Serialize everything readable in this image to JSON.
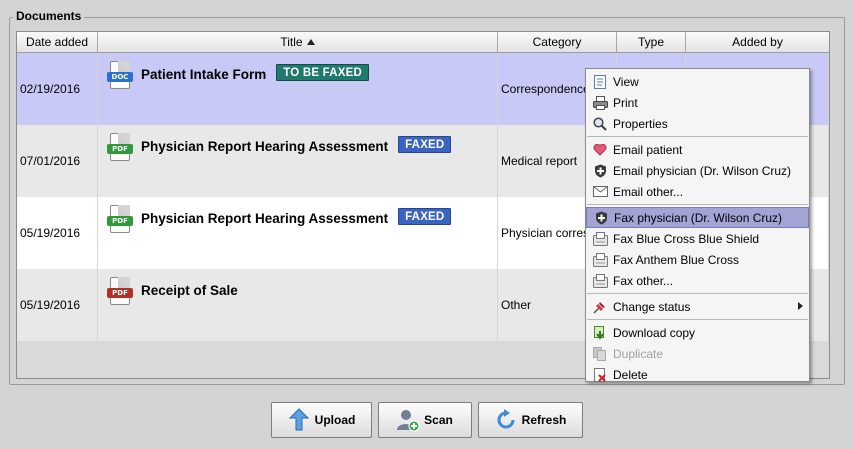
{
  "panel": {
    "legend": "Documents"
  },
  "table": {
    "columns": [
      "Date added",
      "Title",
      "Category",
      "Type",
      "Added by"
    ],
    "rows": [
      {
        "date": "02/19/2016",
        "file_type": "DOC",
        "title": "Patient Intake Form",
        "badge": "TO BE FAXED",
        "category": "Correspondence"
      },
      {
        "date": "07/01/2016",
        "file_type": "PDF",
        "title": "Physician Report Hearing Assessment",
        "badge": "FAXED",
        "category": "Medical report"
      },
      {
        "date": "05/19/2016",
        "file_type": "PDF",
        "title": "Physician Report Hearing Assessment",
        "badge": "FAXED",
        "category": "Physician correspondence"
      },
      {
        "date": "05/19/2016",
        "file_type": "PDF",
        "title": "Receipt of Sale",
        "badge": "",
        "category": "Other"
      }
    ]
  },
  "context_menu": {
    "view": "View",
    "print": "Print",
    "properties": "Properties",
    "email_patient": "Email patient",
    "email_physician": "Email physician (Dr. Wilson Cruz)",
    "email_other": "Email other...",
    "fax_physician": "Fax physician (Dr. Wilson Cruz)",
    "fax_bcbs": "Fax Blue Cross Blue Shield",
    "fax_anthem": "Fax Anthem Blue Cross",
    "fax_other": "Fax other...",
    "change_status": "Change status",
    "download_copy": "Download copy",
    "duplicate": "Duplicate",
    "delete": "Delete"
  },
  "buttons": {
    "upload": "Upload",
    "scan": "Scan",
    "refresh": "Refresh"
  },
  "colors": {
    "selected_row": "#c9c9f7",
    "to_be_faxed": "#1f7a6e",
    "faxed": "#3b63c2",
    "menu_highlight": "#a3a3d6"
  }
}
